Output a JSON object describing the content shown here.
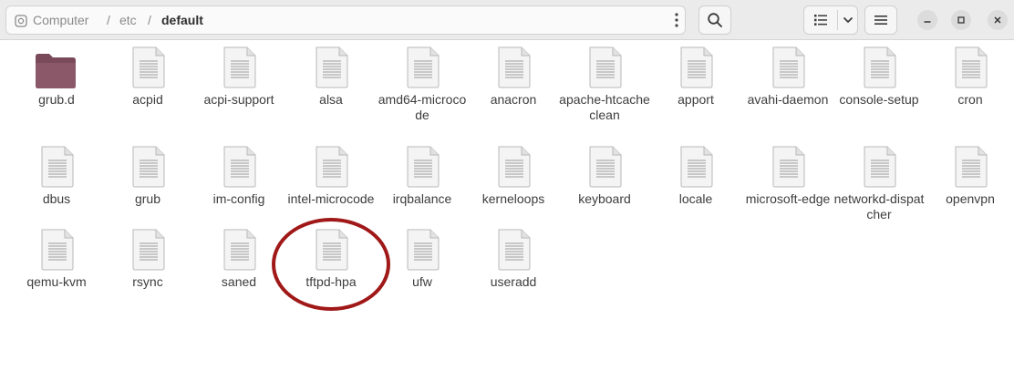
{
  "breadcrumb": {
    "root": "Computer",
    "seg1": "etc",
    "current": "default",
    "separator": "/"
  },
  "toolbar": {
    "path_menu_icon": "vertical-dots-icon",
    "search_icon": "search-icon",
    "view_list_icon": "list-view-icon",
    "view_options_icon": "chevron-down-icon",
    "main_menu_icon": "hamburger-menu-icon",
    "minimize_icon": "minimize-icon",
    "maximize_icon": "maximize-icon",
    "close_icon": "close-icon"
  },
  "files": [
    {
      "name": "grub.d",
      "type": "folder"
    },
    {
      "name": "acpid",
      "type": "file"
    },
    {
      "name": "acpi-support",
      "type": "file"
    },
    {
      "name": "alsa",
      "type": "file"
    },
    {
      "name": "amd64-microcode",
      "type": "file"
    },
    {
      "name": "anacron",
      "type": "file"
    },
    {
      "name": "apache-htcacheclean",
      "type": "file"
    },
    {
      "name": "apport",
      "type": "file"
    },
    {
      "name": "avahi-daemon",
      "type": "file"
    },
    {
      "name": "console-setup",
      "type": "file"
    },
    {
      "name": "cron",
      "type": "file"
    },
    {
      "name": "dbus",
      "type": "file"
    },
    {
      "name": "grub",
      "type": "file"
    },
    {
      "name": "im-config",
      "type": "file"
    },
    {
      "name": "intel-microcode",
      "type": "file"
    },
    {
      "name": "irqbalance",
      "type": "file"
    },
    {
      "name": "kerneloops",
      "type": "file"
    },
    {
      "name": "keyboard",
      "type": "file"
    },
    {
      "name": "locale",
      "type": "file"
    },
    {
      "name": "microsoft-edge",
      "type": "file"
    },
    {
      "name": "networkd-dispatcher",
      "type": "file"
    },
    {
      "name": "openvpn",
      "type": "file"
    },
    {
      "name": "qemu-kvm",
      "type": "file"
    },
    {
      "name": "rsync",
      "type": "file"
    },
    {
      "name": "saned",
      "type": "file"
    },
    {
      "name": "tftpd-hpa",
      "type": "file"
    },
    {
      "name": "ufw",
      "type": "file"
    },
    {
      "name": "useradd",
      "type": "file"
    }
  ],
  "colors": {
    "folder": "#7a4a5a",
    "callout": "#a01818"
  }
}
